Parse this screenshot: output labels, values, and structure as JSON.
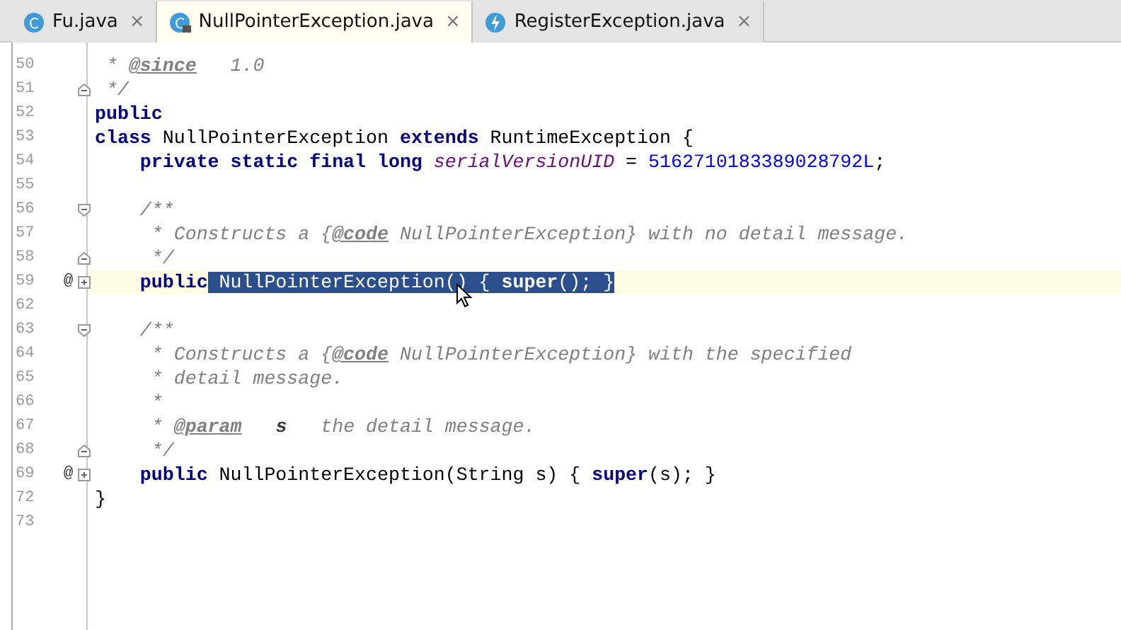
{
  "tabs": [
    {
      "label": "Fu.java",
      "selected": false,
      "kind": "class",
      "icon_text": "C",
      "close": "×"
    },
    {
      "label": "NullPointerException.java",
      "selected": true,
      "kind": "locked",
      "icon_text": "C",
      "close": "×"
    },
    {
      "label": "RegisterException.java",
      "selected": false,
      "kind": "exception",
      "close": "×"
    }
  ],
  "lines": [
    {
      "number": "50",
      "current": false,
      "tokens": [
        {
          "kind": "comment",
          "text": " * "
        },
        {
          "kind": "doctag",
          "text": "@since"
        },
        {
          "kind": "comment",
          "text": "   1.0"
        }
      ]
    },
    {
      "number": "51",
      "fold": {
        "kind": "end"
      },
      "current": false,
      "tokens": [
        {
          "kind": "comment",
          "text": " */"
        }
      ]
    },
    {
      "number": "52",
      "current": false,
      "tokens": [
        {
          "kind": "keyword",
          "text": "public"
        }
      ]
    },
    {
      "number": "53",
      "current": false,
      "tokens": [
        {
          "kind": "keyword",
          "text": "class"
        },
        {
          "kind": "plain",
          "text": " NullPointerException "
        },
        {
          "kind": "keyword",
          "text": "extends"
        },
        {
          "kind": "plain",
          "text": " RuntimeException {"
        }
      ]
    },
    {
      "number": "54",
      "current": false,
      "tokens": [
        {
          "kind": "keyword",
          "text": "    private static final long"
        },
        {
          "kind": "field",
          "text": " serialVersionUID"
        },
        {
          "kind": "plain",
          "text": " = "
        },
        {
          "kind": "number",
          "text": "5162710183389028792L"
        },
        {
          "kind": "plain",
          "text": ";"
        }
      ]
    },
    {
      "number": "55",
      "current": false
    },
    {
      "number": "56",
      "fold": {
        "kind": "start"
      },
      "current": false,
      "tokens": [
        {
          "kind": "comment",
          "text": "    /**"
        }
      ]
    },
    {
      "number": "57",
      "current": false,
      "tokens": [
        {
          "kind": "comment",
          "text": "     * Constructs a {"
        },
        {
          "kind": "doctag",
          "text": "@code"
        },
        {
          "kind": "comment",
          "text": " NullPointerException} with no detail message."
        }
      ]
    },
    {
      "number": "58",
      "fold": {
        "kind": "end"
      },
      "current": false,
      "tokens": [
        {
          "kind": "comment",
          "text": "     */"
        }
      ]
    },
    {
      "number": "59",
      "marker": "@",
      "fold": {
        "kind": "collapsed"
      },
      "current": true,
      "tokens": [
        {
          "kind": "keyword",
          "text": "    public"
        },
        {
          "kind": "plain",
          "text": " NullPointerException() { ",
          "selected": true
        },
        {
          "kind": "keyword",
          "text": "super",
          "selected": true
        },
        {
          "kind": "plain",
          "text": "(); }",
          "selected": true
        }
      ]
    },
    {
      "number": "62",
      "current": false
    },
    {
      "number": "63",
      "fold": {
        "kind": "start"
      },
      "current": false,
      "tokens": [
        {
          "kind": "comment",
          "text": "    /**"
        }
      ]
    },
    {
      "number": "64",
      "current": false,
      "tokens": [
        {
          "kind": "comment",
          "text": "     * Constructs a {"
        },
        {
          "kind": "doctag",
          "text": "@code"
        },
        {
          "kind": "comment",
          "text": " NullPointerException} with the specified"
        }
      ]
    },
    {
      "number": "65",
      "current": false,
      "tokens": [
        {
          "kind": "comment",
          "text": "     * detail message."
        }
      ]
    },
    {
      "number": "66",
      "current": false,
      "tokens": [
        {
          "kind": "comment",
          "text": "     *"
        }
      ]
    },
    {
      "number": "67",
      "current": false,
      "tokens": [
        {
          "kind": "comment",
          "text": "     * "
        },
        {
          "kind": "doctag",
          "text": "@param"
        },
        {
          "kind": "param",
          "text": "   s"
        },
        {
          "kind": "comment",
          "text": "   the detail message."
        }
      ]
    },
    {
      "number": "68",
      "fold": {
        "kind": "end"
      },
      "current": false,
      "tokens": [
        {
          "kind": "comment",
          "text": "     */"
        }
      ]
    },
    {
      "number": "69",
      "marker": "@",
      "fold": {
        "kind": "collapsed"
      },
      "current": false,
      "tokens": [
        {
          "kind": "keyword",
          "text": "    public"
        },
        {
          "kind": "plain",
          "text": " NullPointerException(String s) { "
        },
        {
          "kind": "keyword",
          "text": "super"
        },
        {
          "kind": "plain",
          "text": "(s); }"
        }
      ]
    },
    {
      "number": "72",
      "current": false,
      "tokens": [
        {
          "kind": "plain",
          "text": "}"
        }
      ]
    },
    {
      "number": "73",
      "current": false
    }
  ]
}
